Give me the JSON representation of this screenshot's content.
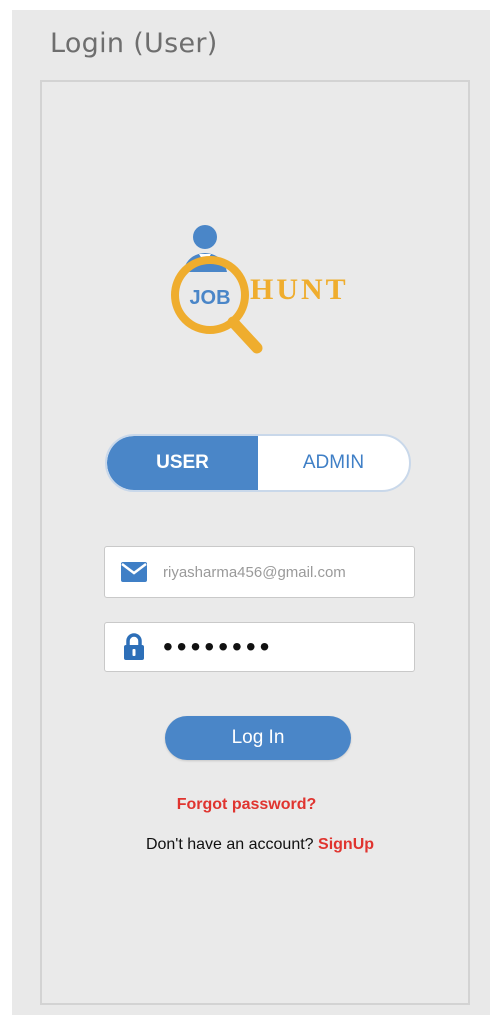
{
  "window": {
    "title": "Login (User)"
  },
  "logo": {
    "badge_text": "JOB",
    "brand_text": "HUNT",
    "colors": {
      "primary": "#efad2e",
      "person": "#4a86c8"
    }
  },
  "role_toggle": {
    "options": [
      {
        "label": "USER",
        "selected": true
      },
      {
        "label": "ADMIN",
        "selected": false
      }
    ]
  },
  "email_field": {
    "icon": "mail-icon",
    "value": "riyasharma456@gmail.com"
  },
  "password_field": {
    "icon": "lock-icon",
    "value": "••••••••"
  },
  "login_button": {
    "label": "Log In"
  },
  "forgot_password": {
    "label": "Forgot password?"
  },
  "signup": {
    "prompt": "Don't have an account?",
    "link_label": "SignUp"
  },
  "colors": {
    "accent": "#4a86c8",
    "link": "#e0342f",
    "background": "#e9e9e9"
  }
}
